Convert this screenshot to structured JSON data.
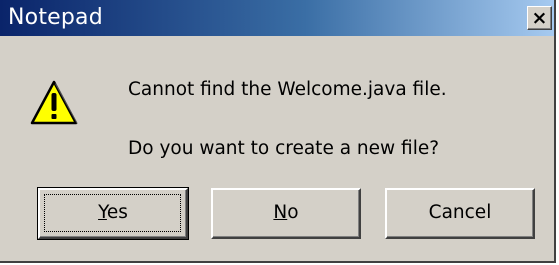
{
  "window": {
    "title": "Notepad",
    "close_label": "×"
  },
  "icon": "warning-icon",
  "message": {
    "line1": "Cannot find the Welcome.java file.",
    "line2": "Do you want to create a new file?"
  },
  "buttons": {
    "yes": {
      "accel": "Y",
      "rest": "es"
    },
    "no": {
      "accel": "N",
      "rest": "o"
    },
    "cancel": "Cancel"
  },
  "colors": {
    "titlebar_start": "#0a246a",
    "titlebar_end": "#a6caf0",
    "dialog_bg": "#d4d0c8",
    "warning_yellow": "#ffff00"
  }
}
